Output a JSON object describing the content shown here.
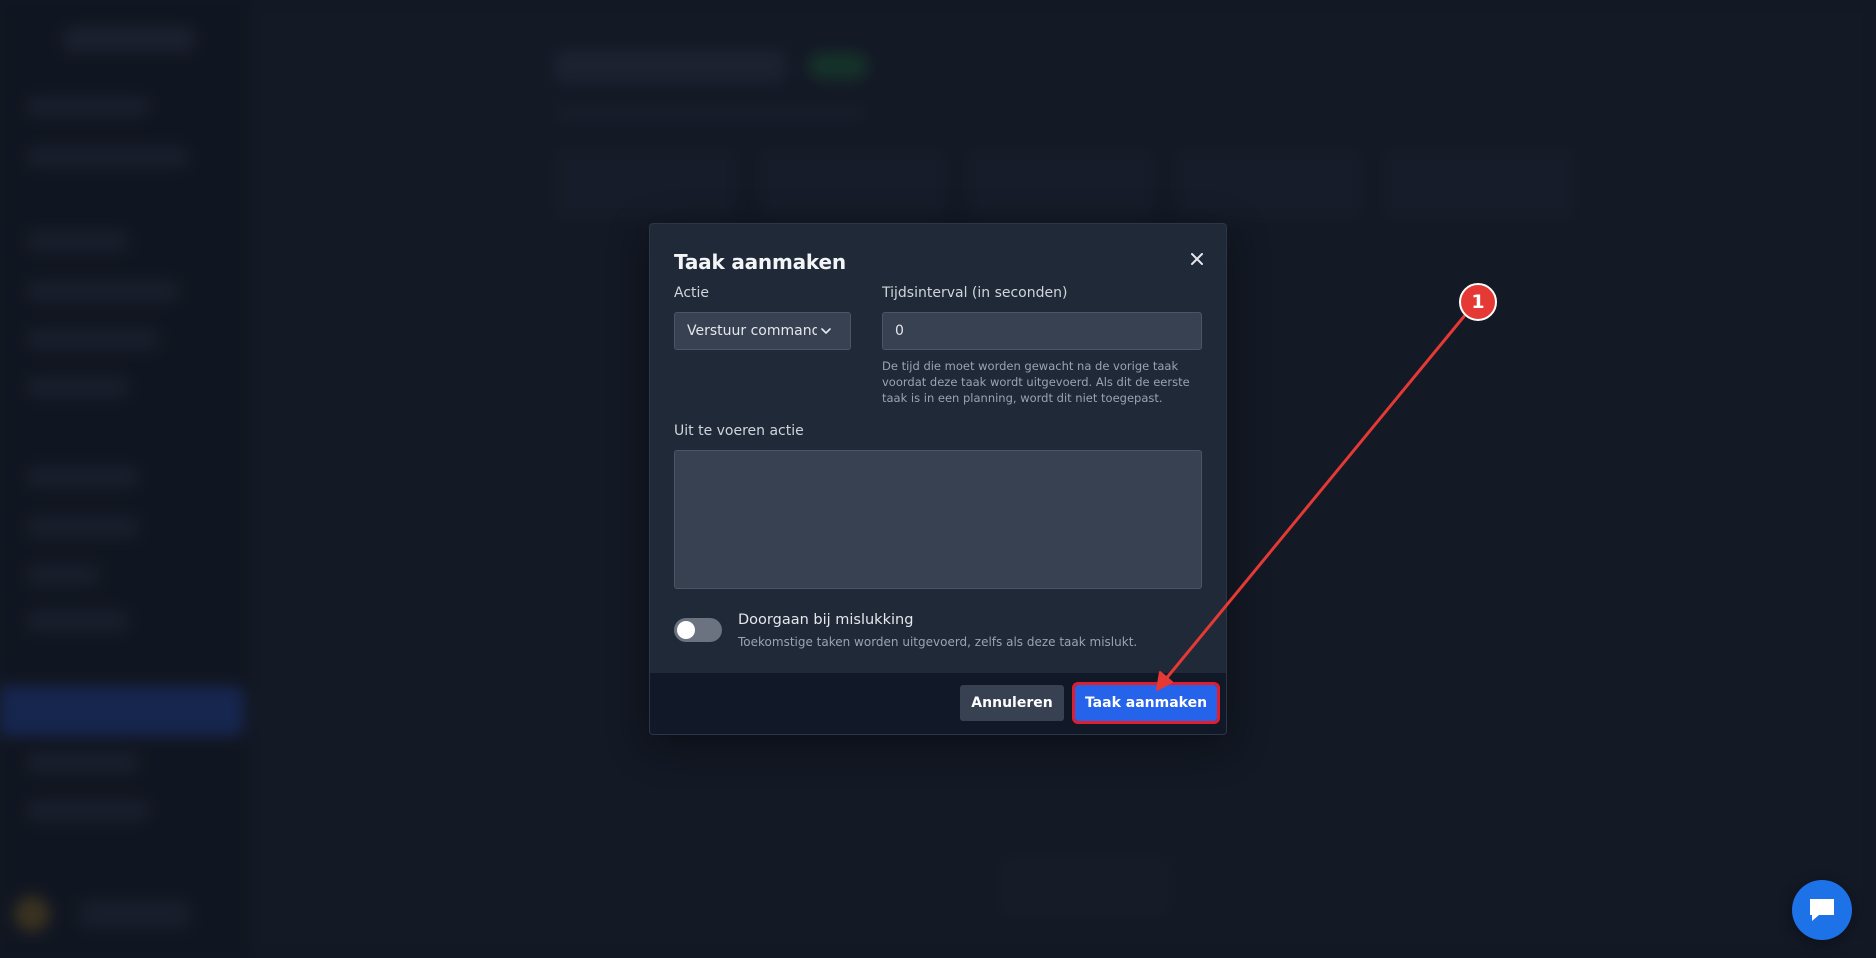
{
  "modal": {
    "title": "Taak aanmaken",
    "close_icon": "close-icon",
    "action_label": "Actie",
    "action_value": "Verstuur commando",
    "interval_label": "Tijdsinterval (in seconden)",
    "interval_value": "0",
    "interval_help": "De tijd die moet worden gewacht na de vorige taak voordat deze taak wordt uitgevoerd. Als dit de eerste taak is in een planning, wordt dit niet toegepast.",
    "payload_label": "Uit te voeren actie",
    "payload_value": "",
    "continue_on_failure": {
      "title": "Doorgaan bij mislukking",
      "description": "Toekomstige taken worden uitgevoerd, zelfs als deze taak mislukt.",
      "enabled": false
    },
    "cancel_label": "Annuleren",
    "submit_label": "Taak aanmaken"
  },
  "annotation": {
    "step": "1",
    "color": "#e53935"
  },
  "chat_icon": "chat-bubble-icon",
  "colors": {
    "primary": "#2563eb",
    "modal_bg": "#1f2937",
    "footer_bg": "#111827",
    "input_bg": "#374151",
    "highlight": "#e11d2e"
  }
}
